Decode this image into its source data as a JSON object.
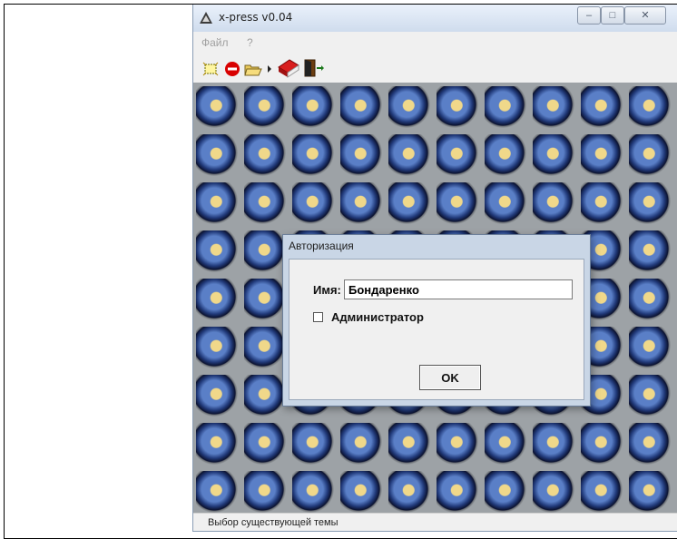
{
  "window": {
    "title": "x-press v0.04",
    "controls": {
      "minimize": "–",
      "maximize": "□",
      "close": "✕"
    }
  },
  "menu": {
    "file_label": "Файл",
    "help_label": "?"
  },
  "toolbar": {
    "icons": [
      "new-theme-icon",
      "stop-icon",
      "open-folder-icon",
      "arrow-icon",
      "book-icon",
      "exit-door-icon"
    ]
  },
  "dialog": {
    "title": "Авторизация",
    "name_label": "Имя:",
    "name_value": "Бондаренко",
    "admin_label": "Администратор",
    "admin_checked": false,
    "ok_label": "OK"
  },
  "status": {
    "text": "Выбор существующей темы"
  },
  "colors": {
    "desktop_bg": "#9da2a6",
    "titlebar": "#dde7f3",
    "dialog_frame": "#c9d6e6"
  }
}
